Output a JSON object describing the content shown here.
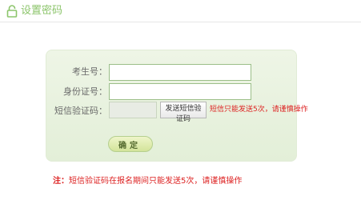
{
  "header": {
    "title": "设置密码",
    "icon": "lock-icon",
    "accent_color": "#8cc56b"
  },
  "form": {
    "fields": [
      {
        "label": "考生号：",
        "value": "",
        "placeholder": ""
      },
      {
        "label": "身份证号：",
        "value": "",
        "placeholder": ""
      },
      {
        "label": "短信验证码：",
        "value": "",
        "placeholder": ""
      }
    ],
    "sms_button_label": "发送短信验证码",
    "sms_tip": "短信只能发送5次，请谨慎操作",
    "confirm_label": "确定"
  },
  "note": {
    "prefix": "注：",
    "text": "短信验证码在报名期间只能发送5次，请谨慎操作"
  },
  "colors": {
    "error": "#dd2222",
    "panel_bg": "#e8f2df"
  }
}
